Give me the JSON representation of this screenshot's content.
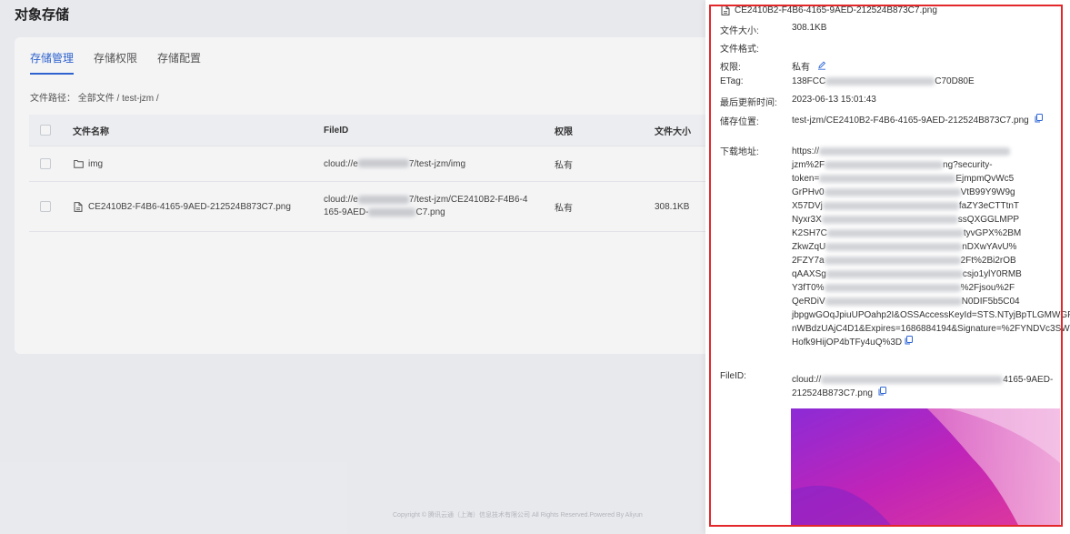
{
  "app": {
    "page_title": "对象存储",
    "tabs": [
      {
        "label": "存储管理",
        "active": true
      },
      {
        "label": "存储权限",
        "active": false
      },
      {
        "label": "存储配置",
        "active": false
      }
    ],
    "path_label": "文件路径：",
    "path_value": "全部文件 / test-jzm /",
    "table": {
      "headers": [
        "文件名称",
        "FileID",
        "权限",
        "文件大小"
      ],
      "rows": [
        {
          "icon": "folder-icon",
          "name": "img",
          "fileid_prefix": "cloud://e",
          "fileid_suffix": "7/test-jzm/img",
          "perm": "私有",
          "size": ""
        },
        {
          "icon": "file-icon",
          "name": "CE2410B2-F4B6-4165-9AED-212524B873C7.png",
          "fileid_prefix": "cloud://e",
          "fileid_suffix": "7/test-jzm/CE2410B2-F4B6-4",
          "fileid_line2_prefix": "165-9AED-",
          "fileid_line2_suffix": "C7.png",
          "perm": "私有",
          "size": "308.1KB"
        }
      ]
    },
    "footer_text": "Copyright © 腾讯云通（上海）信息技术有限公司 All Rights Reserved.Powered By Aliyun"
  },
  "drawer": {
    "file_title": "CE2410B2-F4B6-4165-9AED-212524B873C7.png",
    "fields": {
      "size_label": "文件大小:",
      "size_value": "308.1KB",
      "format_label": "文件格式:",
      "format_value": "",
      "perm_label": "权限:",
      "perm_value": "私有",
      "etag_label": "ETag:",
      "etag_prefix": "138FCC",
      "etag_suffix": "C70D80E",
      "updated_label": "最后更新时间:",
      "updated_value": "2023-06-13 15:01:43",
      "storage_label": "储存位置:",
      "storage_value": "test-jzm/CE2410B2-F4B6-4165-9AED-212524B873C7.png",
      "download_label": "下载地址:",
      "fileid_label": "FileID:"
    },
    "download_url_lines": [
      {
        "pre": "https://",
        "post": ""
      },
      {
        "pre": "jzm%2F",
        "post": "ng?security-"
      },
      {
        "pre": "token=",
        "post": "EjmpmQvWc5"
      },
      {
        "pre": "GrPHv0",
        "post": "VtB99Y9W9g"
      },
      {
        "pre": "X57DVj",
        "post": "faZY3eCTTtnT"
      },
      {
        "pre": "Nyxr3X",
        "post": "ssQXGGLMPP"
      },
      {
        "pre": "K2SH7C",
        "post": "tyvGPX%2BM"
      },
      {
        "pre": "ZkwZqU",
        "post": "nDXwYAvU%"
      },
      {
        "pre": "2FZY7a",
        "post": "2Ft%2Bi2rOB"
      },
      {
        "pre": "qAAXSg",
        "post": "csjo1ylY0RMB"
      },
      {
        "pre": "Y3fT0%",
        "post": "%2Fjsou%2F"
      },
      {
        "pre": "QeRDiV",
        "post": "N0DIF5b5C04"
      },
      {
        "pre": "jbpgwGOqJpiuUPOahp2I&OSSAccessKeyId=STS.NTyjBpTLGMWGF",
        "post": ""
      },
      {
        "pre": "nWBdzUAjC4D1&Expires=1686884194&Signature=%2FYNDVc3SW",
        "post": ""
      },
      {
        "pre": "Hofk9HijOP4bTFy4uQ%3D",
        "post": ""
      }
    ],
    "fileid_line1_pre": "cloud://",
    "fileid_line1_post": "4165-9AED-",
    "fileid_line2": "212524B873C7.png",
    "colors": {
      "accent": "#2f66d6",
      "frame": "#e3272b"
    }
  }
}
